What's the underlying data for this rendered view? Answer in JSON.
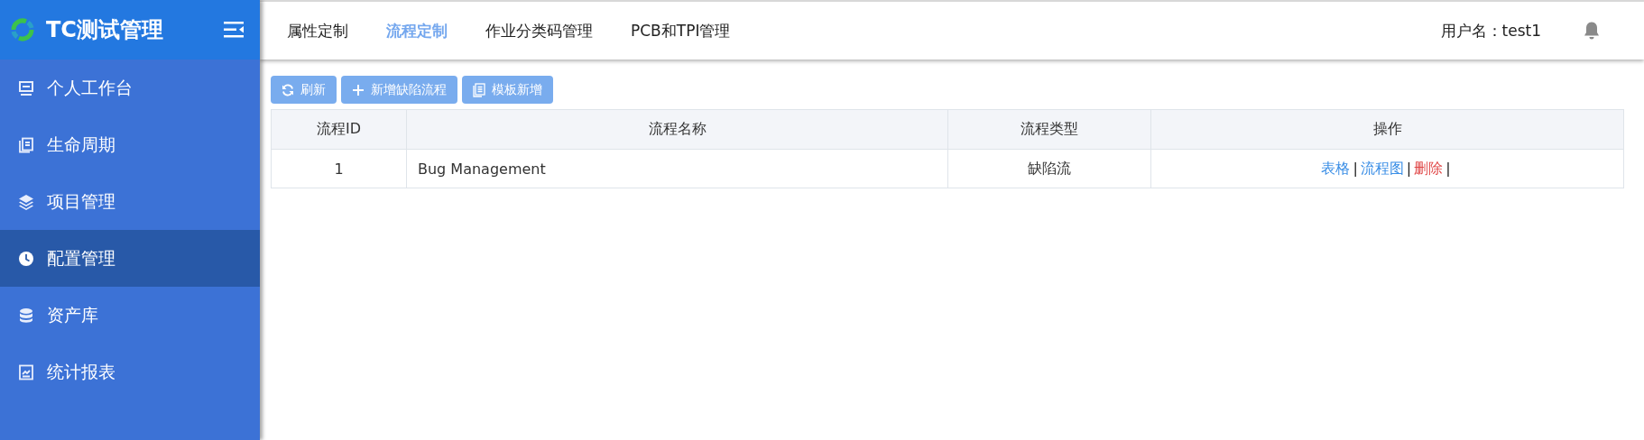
{
  "app": {
    "title": "TC测试管理"
  },
  "sidebar": {
    "items": [
      {
        "label": "个人工作台",
        "selected": false
      },
      {
        "label": "生命周期",
        "selected": false
      },
      {
        "label": "项目管理",
        "selected": false
      },
      {
        "label": "配置管理",
        "selected": true
      },
      {
        "label": "资产库",
        "selected": false
      },
      {
        "label": "统计报表",
        "selected": false
      }
    ]
  },
  "tabs": [
    {
      "label": "属性定制",
      "selected": false
    },
    {
      "label": "流程定制",
      "selected": true
    },
    {
      "label": "作业分类码管理",
      "selected": false
    },
    {
      "label": "PCB和TPI管理",
      "selected": false
    }
  ],
  "user": {
    "label": "用户名：test1"
  },
  "toolbar": [
    {
      "label": "刷新"
    },
    {
      "label": "新增缺陷流程"
    },
    {
      "label": "模板新增"
    }
  ],
  "table": {
    "columns": [
      "流程ID",
      "流程名称",
      "流程类型",
      "操作"
    ],
    "rows": [
      {
        "id": "1",
        "name": "Bug Management",
        "type": "缺陷流",
        "actions": [
          {
            "label": "表格",
            "kind": "link",
            "separator": "|"
          },
          {
            "label": "流程图",
            "kind": "link",
            "separator": "|"
          },
          {
            "label": "删除",
            "kind": "danger",
            "separator": "|"
          }
        ]
      }
    ]
  }
}
